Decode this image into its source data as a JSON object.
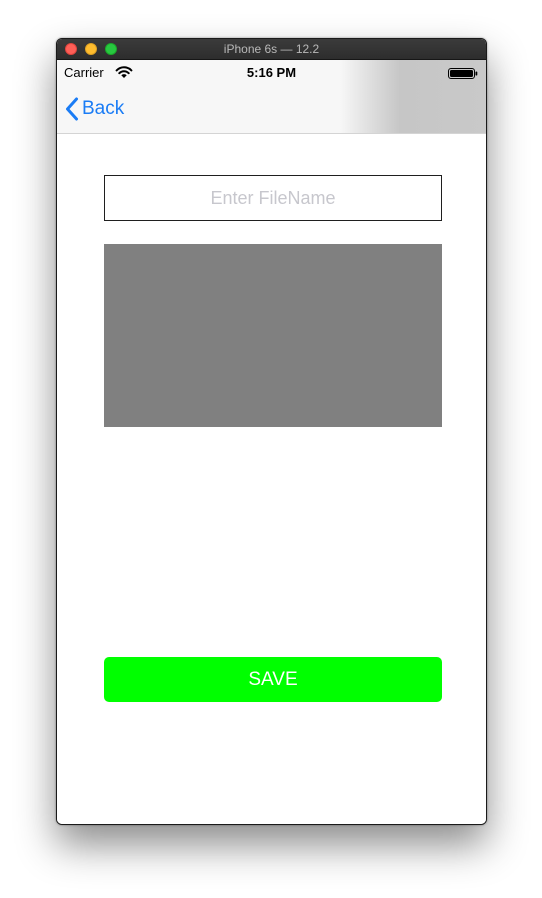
{
  "window": {
    "title": "iPhone 6s — 12.2"
  },
  "statusbar": {
    "carrier": "Carrier",
    "time": "5:16 PM"
  },
  "navbar": {
    "back_label": "Back"
  },
  "form": {
    "filename_placeholder": "Enter FileName",
    "filename_value": "",
    "save_label": "SAVE"
  },
  "colors": {
    "accent": "#1a7cf5",
    "save_button": "#00ff00",
    "image_placeholder": "#808080"
  },
  "icons": [
    "wifi-icon",
    "battery-icon",
    "back-chevron-icon"
  ]
}
